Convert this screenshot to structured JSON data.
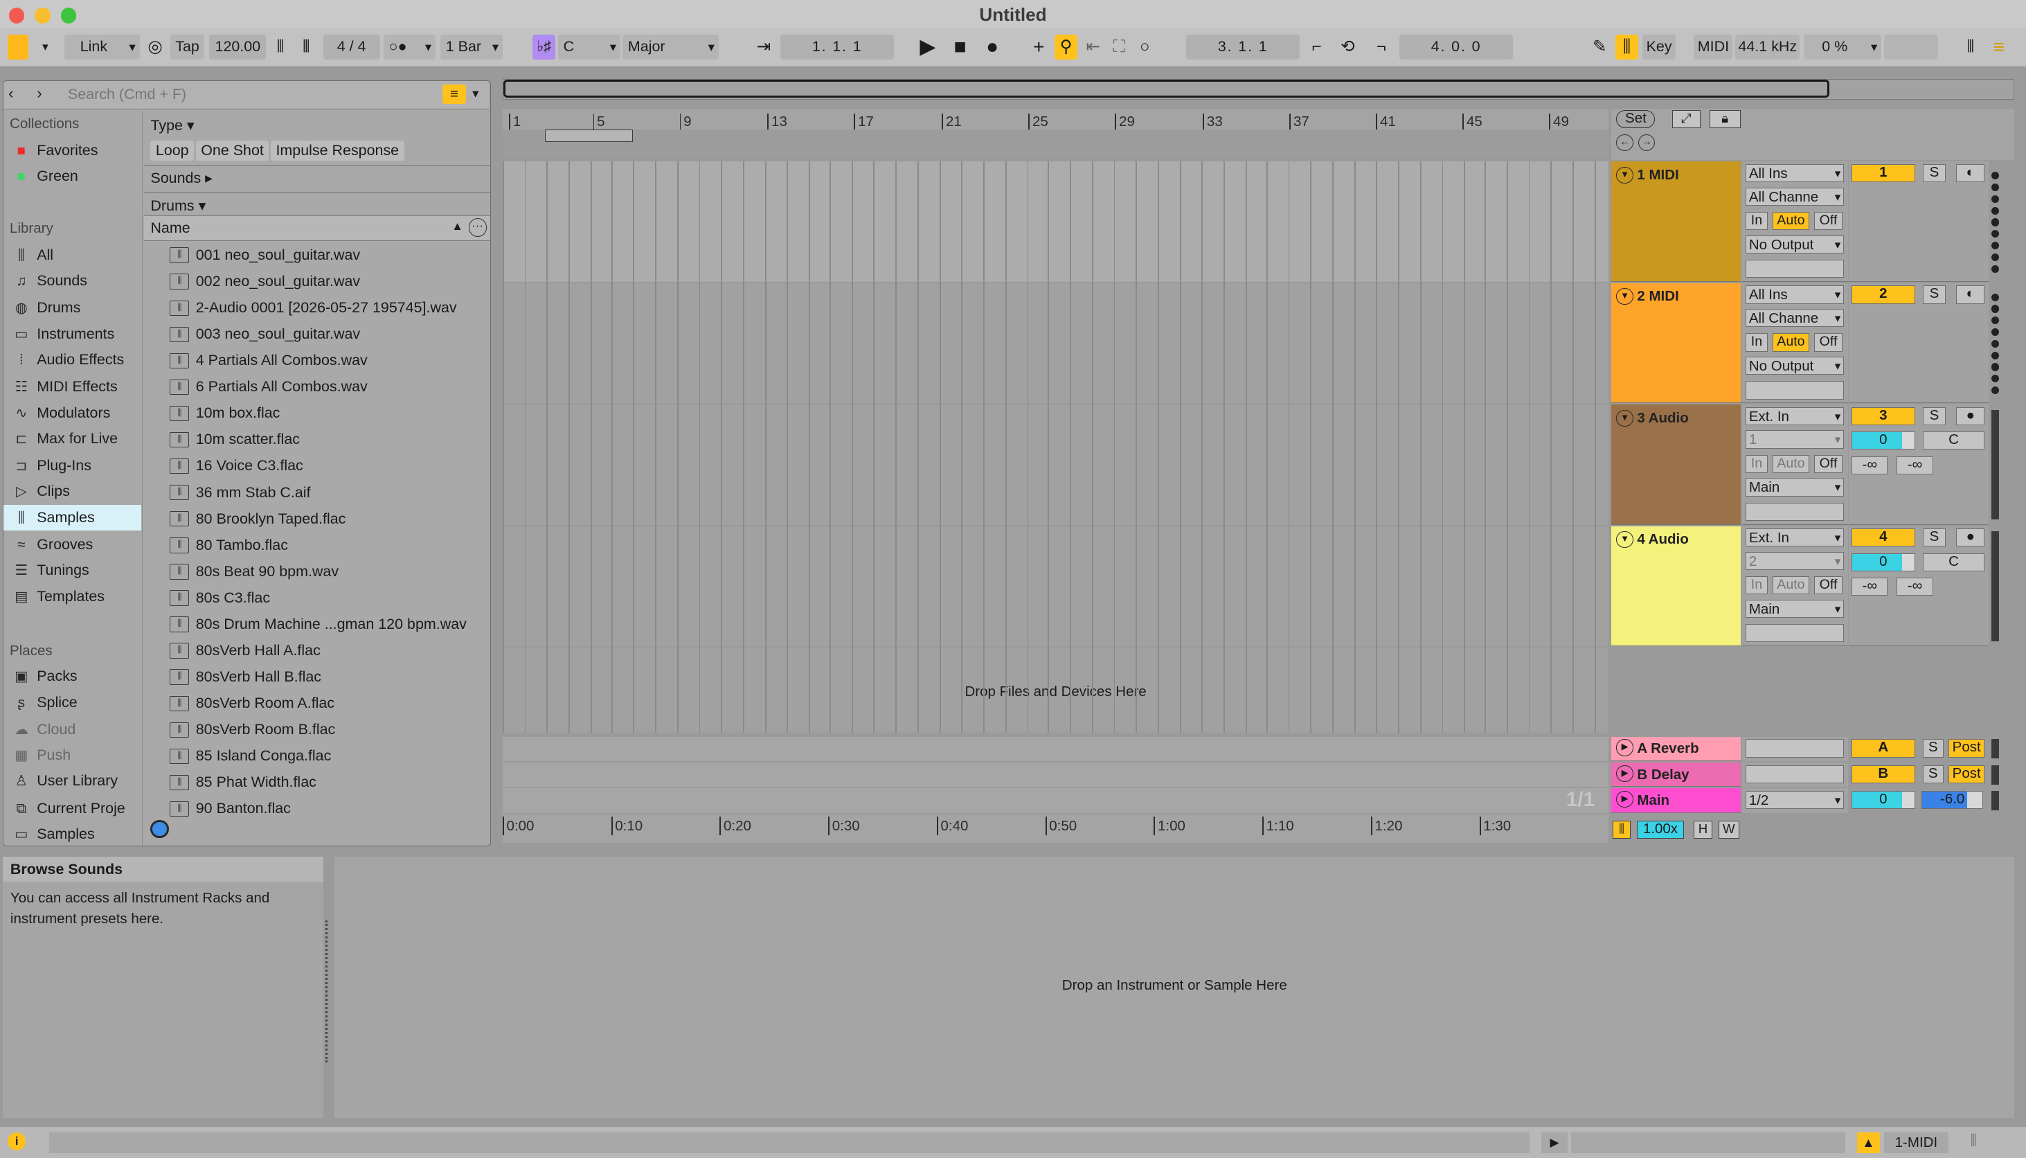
{
  "window": {
    "title": "Untitled"
  },
  "toolbar": {
    "link": "Link",
    "tap": "Tap",
    "tempo": "120.00",
    "signature": "4 / 4",
    "quantize": "1 Bar",
    "key": "C",
    "scale": "Major",
    "position": "1.   1.   1",
    "loop_start": "3.   1.   1",
    "loop_length": "4.   0.   0",
    "key_map": "Key",
    "midi_map": "MIDI",
    "sample_rate": "44.1 kHz",
    "cpu": "0 %"
  },
  "browser": {
    "search_placeholder": "Search (Cmd + F)",
    "collections_label": "Collections",
    "collections": [
      {
        "label": "Favorites",
        "color": "#ef2b2b"
      },
      {
        "label": "Green",
        "color": "#43d36a"
      }
    ],
    "library_label": "Library",
    "library": [
      "All",
      "Sounds",
      "Drums",
      "Instruments",
      "Audio Effects",
      "MIDI Effects",
      "Modulators",
      "Max for Live",
      "Plug-Ins",
      "Clips",
      "Samples",
      "Grooves",
      "Tunings",
      "Templates"
    ],
    "places_label": "Places",
    "places": [
      "Packs",
      "Splice",
      "Cloud",
      "Push",
      "User Library",
      "Current Proje",
      "Samples"
    ],
    "filters": {
      "type_label": "Type",
      "type_chips": [
        "Loop",
        "One Shot",
        "Impulse Response"
      ],
      "sounds_label": "Sounds",
      "drums_label": "Drums"
    },
    "name_header": "Name",
    "files": [
      "001 neo_soul_guitar.wav",
      "002 neo_soul_guitar.wav",
      "2-Audio 0001 [2026-05-27 195745].wav",
      "003 neo_soul_guitar.wav",
      "4 Partials All Combos.wav",
      "6 Partials All Combos.wav",
      "10m box.flac",
      "10m scatter.flac",
      "16 Voice C3.flac",
      "36 mm Stab C.aif",
      "80 Brooklyn Taped.flac",
      "80 Tambo.flac",
      "80s Beat 90 bpm.wav",
      "80s C3.flac",
      "80s Drum Machine ...gman 120 bpm.wav",
      "80sVerb Hall A.flac",
      "80sVerb Hall B.flac",
      "80sVerb Room A.flac",
      "80sVerb Room B.flac",
      "85 Island Conga.flac",
      "85 Phat Width.flac",
      "90 Banton.flac"
    ]
  },
  "arrangement": {
    "bar_ticks": [
      "1",
      "5",
      "9",
      "13",
      "17",
      "21",
      "25",
      "29",
      "33",
      "37",
      "41",
      "45",
      "49"
    ],
    "time_ticks": [
      "0:00",
      "0:10",
      "0:20",
      "0:30",
      "0:40",
      "0:50",
      "1:00",
      "1:10",
      "1:20",
      "1:30"
    ],
    "drop_files": "Drop Files and Devices Here",
    "set_button": "Set",
    "page_indicator": "1/1",
    "zoom": "1.00x",
    "h_btn": "H",
    "w_btn": "W"
  },
  "tracks": [
    {
      "name": "1 MIDI",
      "color": "#c9981f",
      "input": "All Ins",
      "channel": "All Channe",
      "output": "No Output",
      "number": "1",
      "solo": "S"
    },
    {
      "name": "2 MIDI",
      "color": "#ffa42b",
      "input": "All Ins",
      "channel": "All Channe",
      "output": "No Output",
      "number": "2",
      "solo": "S"
    },
    {
      "name": "3 Audio",
      "color": "#9a7148",
      "input": "Ext. In",
      "channel": "1",
      "output": "Main",
      "number": "3",
      "solo": "S",
      "volume": "0",
      "pan": "C",
      "send_a": "-∞",
      "send_b": "-∞"
    },
    {
      "name": "4 Audio",
      "color": "#f4f27c",
      "input": "Ext. In",
      "channel": "2",
      "output": "Main",
      "number": "4",
      "solo": "S",
      "volume": "0",
      "pan": "C",
      "send_a": "-∞",
      "send_b": "-∞"
    }
  ],
  "returns": [
    {
      "name": "A Reverb",
      "color": "#ff9db2",
      "letter": "A",
      "solo": "S",
      "post": "Post"
    },
    {
      "name": "B Delay",
      "color": "#ec6bb2",
      "letter": "B",
      "solo": "S",
      "post": "Post"
    }
  ],
  "main": {
    "name": "Main",
    "color": "#ff4fd0",
    "output": "1/2",
    "volume": "0",
    "gain": "-6.0"
  },
  "io_labels": {
    "in": "In",
    "auto": "Auto",
    "off": "Off"
  },
  "info": {
    "title": "Browse Sounds",
    "text": "You can access all Instrument Racks and instrument presets here."
  },
  "device": {
    "drop": "Drop an Instrument or Sample Here"
  },
  "status": {
    "track": "1-MIDI"
  }
}
